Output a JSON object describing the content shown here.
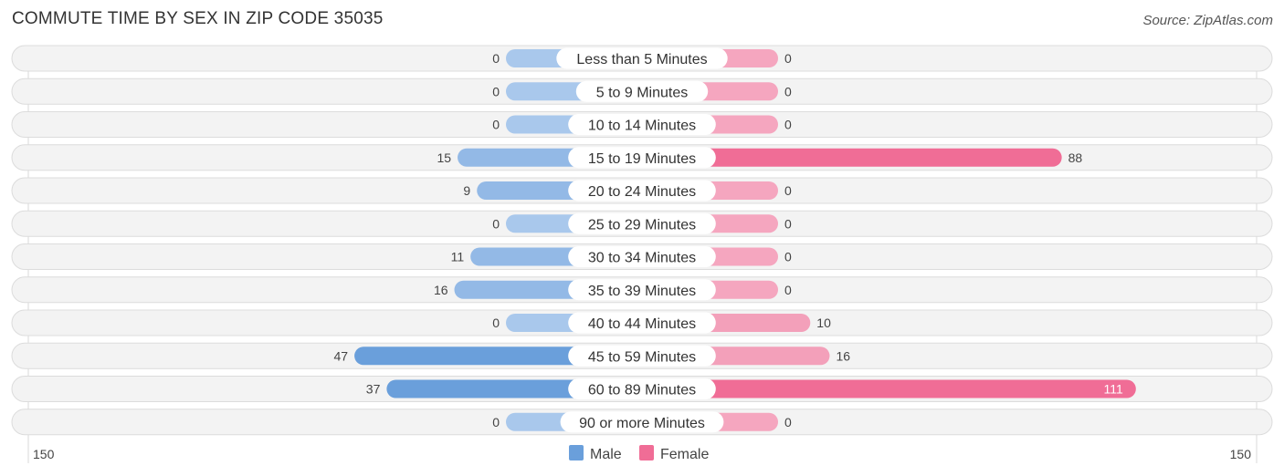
{
  "title": "COMMUTE TIME BY SEX IN ZIP CODE 35035",
  "source": "Source: ZipAtlas.com",
  "colors": {
    "male": "#6a9fdb",
    "male_light": "#a9c8ec",
    "female": "#f06d96",
    "female_light": "#f5a6bf"
  },
  "chart_data": {
    "type": "bar",
    "orientation": "horizontal-diverging",
    "title": "COMMUTE TIME BY SEX IN ZIP CODE 35035",
    "categories": [
      "Less than 5 Minutes",
      "5 to 9 Minutes",
      "10 to 14 Minutes",
      "15 to 19 Minutes",
      "20 to 24 Minutes",
      "25 to 29 Minutes",
      "30 to 34 Minutes",
      "35 to 39 Minutes",
      "40 to 44 Minutes",
      "45 to 59 Minutes",
      "60 to 89 Minutes",
      "90 or more Minutes"
    ],
    "series": [
      {
        "name": "Male",
        "values": [
          0,
          0,
          0,
          15,
          9,
          0,
          11,
          16,
          0,
          47,
          37,
          0
        ]
      },
      {
        "name": "Female",
        "values": [
          0,
          0,
          0,
          88,
          0,
          0,
          0,
          0,
          10,
          16,
          111,
          0
        ]
      }
    ],
    "axis": {
      "left_label": "150",
      "right_label": "150",
      "range": [
        -150,
        150
      ]
    },
    "legend": {
      "position": "bottom-center",
      "items": [
        "Male",
        "Female"
      ]
    },
    "grid": false
  }
}
